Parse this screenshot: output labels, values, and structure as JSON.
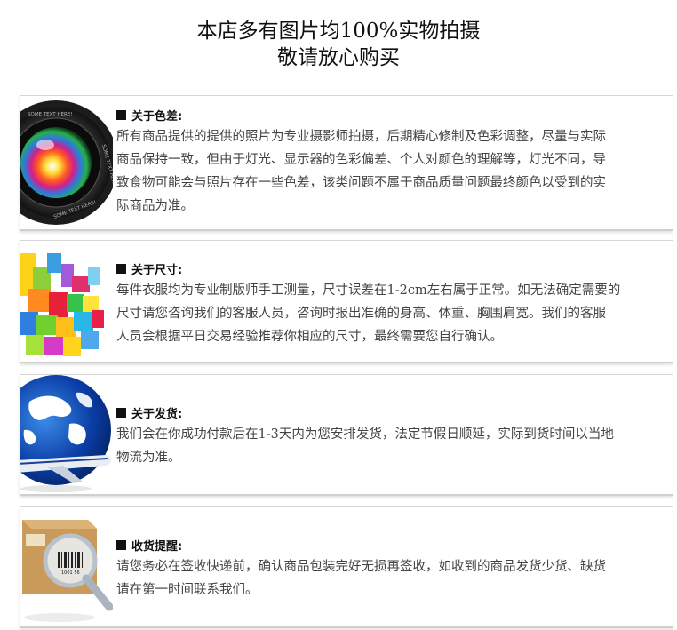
{
  "header": {
    "line1": "本店多有图片均100%实物拍摄",
    "line2": "敬请放心购买"
  },
  "sections": [
    {
      "title": "关于色差:",
      "lines": [
        "所有商品提供的提供的照片为专业摄影师拍摄，后期精心修制及色彩调整，尽量与实际",
        "商品保持一致，但由于灯光、显示器的色彩偏差、个人对颜色的理解等，灯光不同，导",
        "致食物可能会与照片存在一些色差，该类问题不属于商品质量问题最终颜色以受到的实",
        "际商品为准。"
      ]
    },
    {
      "title": "关于尺寸:",
      "lines": [
        "每件衣服均为专业制版师手工测量，尺寸误差在1-2cm左右属于正常。如无法确定需要的",
        "尺寸请您咨询我们的客服人员，咨询时报出准确的身高、体重、胸围肩宽。我们的客服",
        "人员会根据平日交易经验推荐你相应的尺寸，最终需要您自行确认。"
      ]
    },
    {
      "title": "关于发货:",
      "lines": [
        "我们会在你成功付款后在1-3天内为您安排发货，法定节假日顺延，实际到货时间以当地",
        "物流为准。"
      ]
    },
    {
      "title": "收货提醒:",
      "lines": [
        "请您务必在签收快递前，确认商品包装完好无损再签收，如收到的商品发货少货、缺货",
        "请在第一时间联系我们。"
      ]
    }
  ],
  "camera_text": {
    "top": "SOME TEXT HERE!",
    "side": "SOME TEXT HERE!",
    "bottom": "SOME TEXT HERE!"
  },
  "barcode_number": "1001 56"
}
